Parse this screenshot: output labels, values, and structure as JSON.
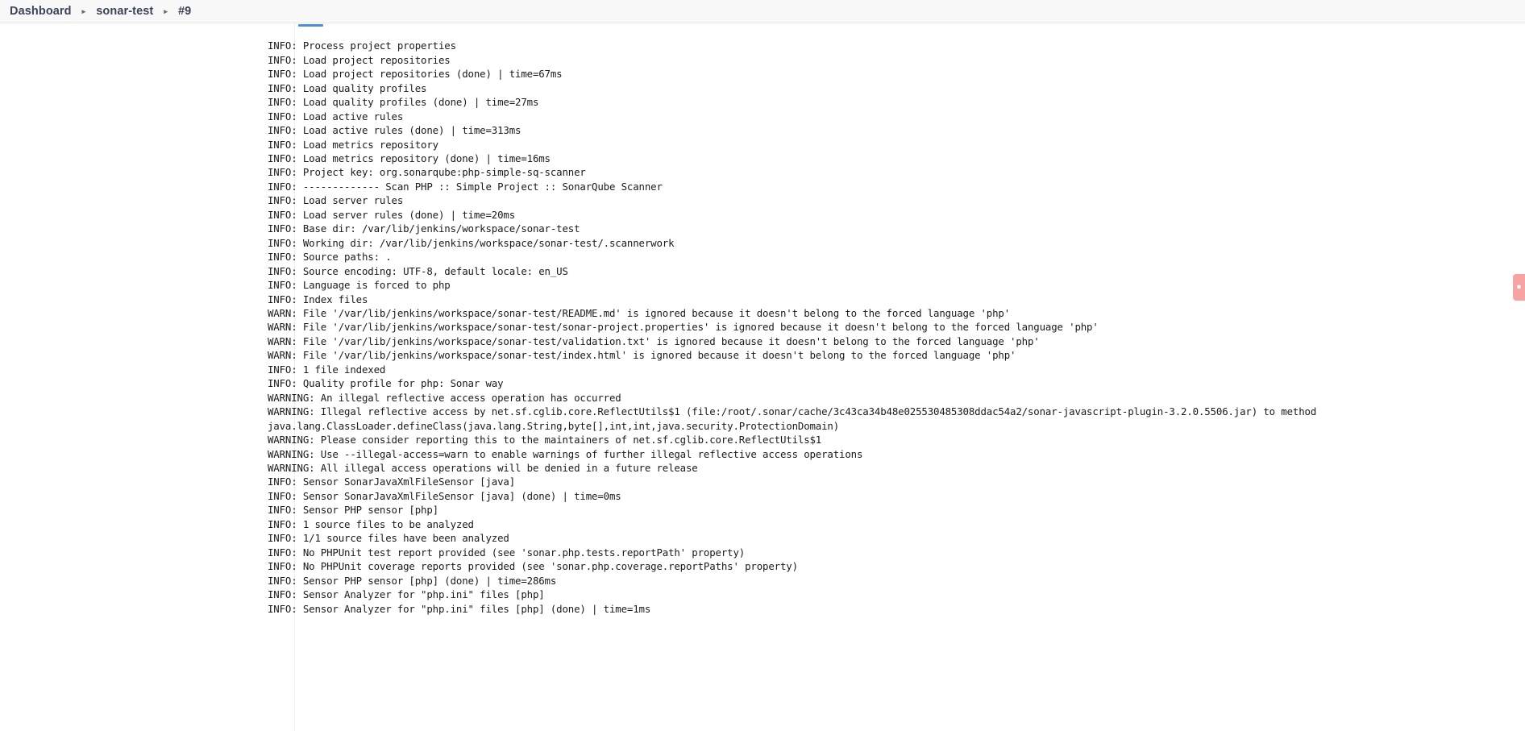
{
  "header": {
    "breadcrumb": [
      {
        "label": "Dashboard",
        "name": "breadcrumb-dashboard"
      },
      {
        "label": "sonar-test",
        "name": "breadcrumb-project"
      },
      {
        "label": "#9",
        "name": "breadcrumb-build"
      }
    ],
    "separator": "▸"
  },
  "right_tab": {
    "glyph": "●",
    "color": "#f7a3a3"
  },
  "progress": {
    "color": "#4a90d9",
    "percent": 4
  },
  "console": {
    "lines": [
      "INFO: Process project properties",
      "INFO: Load project repositories",
      "INFO: Load project repositories (done) | time=67ms",
      "INFO: Load quality profiles",
      "INFO: Load quality profiles (done) | time=27ms",
      "INFO: Load active rules",
      "INFO: Load active rules (done) | time=313ms",
      "INFO: Load metrics repository",
      "INFO: Load metrics repository (done) | time=16ms",
      "INFO: Project key: org.sonarqube:php-simple-sq-scanner",
      "INFO: ------------- Scan PHP :: Simple Project :: SonarQube Scanner",
      "INFO: Load server rules",
      "INFO: Load server rules (done) | time=20ms",
      "INFO: Base dir: /var/lib/jenkins/workspace/sonar-test",
      "INFO: Working dir: /var/lib/jenkins/workspace/sonar-test/.scannerwork",
      "INFO: Source paths: .",
      "INFO: Source encoding: UTF-8, default locale: en_US",
      "INFO: Language is forced to php",
      "INFO: Index files",
      "WARN: File '/var/lib/jenkins/workspace/sonar-test/README.md' is ignored because it doesn't belong to the forced language 'php'",
      "WARN: File '/var/lib/jenkins/workspace/sonar-test/sonar-project.properties' is ignored because it doesn't belong to the forced language 'php'",
      "WARN: File '/var/lib/jenkins/workspace/sonar-test/validation.txt' is ignored because it doesn't belong to the forced language 'php'",
      "WARN: File '/var/lib/jenkins/workspace/sonar-test/index.html' is ignored because it doesn't belong to the forced language 'php'",
      "INFO: 1 file indexed",
      "INFO: Quality profile for php: Sonar way",
      "WARNING: An illegal reflective access operation has occurred",
      "WARNING: Illegal reflective access by net.sf.cglib.core.ReflectUtils$1 (file:/root/.sonar/cache/3c43ca34b48e025530485308ddac54a2/sonar-javascript-plugin-3.2.0.5506.jar) to method",
      "java.lang.ClassLoader.defineClass(java.lang.String,byte[],int,int,java.security.ProtectionDomain)",
      "WARNING: Please consider reporting this to the maintainers of net.sf.cglib.core.ReflectUtils$1",
      "WARNING: Use --illegal-access=warn to enable warnings of further illegal reflective access operations",
      "WARNING: All illegal access operations will be denied in a future release",
      "INFO: Sensor SonarJavaXmlFileSensor [java]",
      "INFO: Sensor SonarJavaXmlFileSensor [java] (done) | time=0ms",
      "INFO: Sensor PHP sensor [php]",
      "INFO: 1 source files to be analyzed",
      "INFO: 1/1 source files have been analyzed",
      "INFO: No PHPUnit test report provided (see 'sonar.php.tests.reportPath' property)",
      "INFO: No PHPUnit coverage reports provided (see 'sonar.php.coverage.reportPaths' property)",
      "INFO: Sensor PHP sensor [php] (done) | time=286ms",
      "INFO: Sensor Analyzer for \"php.ini\" files [php]",
      "INFO: Sensor Analyzer for \"php.ini\" files [php] (done) | time=1ms"
    ]
  }
}
